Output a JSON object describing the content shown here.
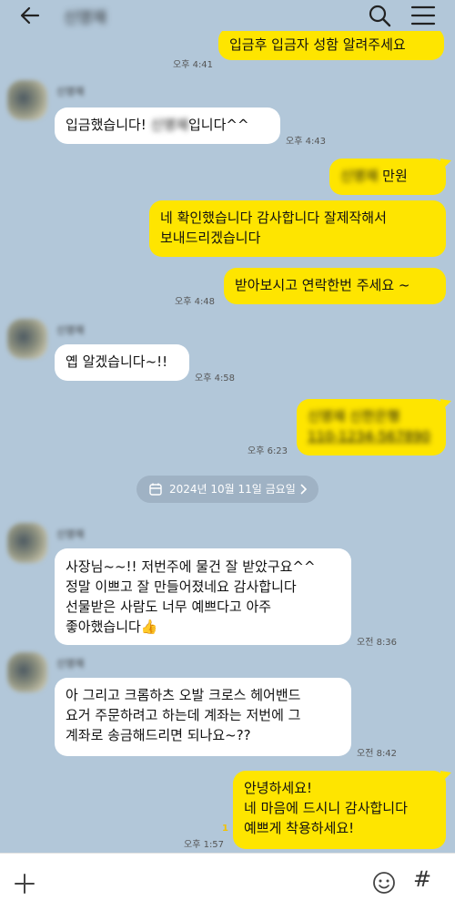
{
  "header": {
    "title": "신영재",
    "back_icon": "back-arrow-icon",
    "search_icon": "search-icon",
    "menu_icon": "hamburger-menu-icon"
  },
  "messages": {
    "m0": {
      "text": "입금후 입금자 성함 알려주세요",
      "time": "오후 4:41"
    },
    "sender_name": "신영재",
    "m1": {
      "text_a": "입금했습니다! ",
      "text_blur": "신영재",
      "text_b": "입니다^^",
      "time": "오후 4:43"
    },
    "m2": {
      "text_blur": "신영재 ",
      "text_b": "만원"
    },
    "m3": {
      "line1": "네 확인했습니다 감사합니다 잘제작해서",
      "line2": "보내드리겠습니다"
    },
    "m4": {
      "text": "받아보시고 연락한번 주세요 ~",
      "time": "오후 4:48"
    },
    "m5": {
      "text": "옙 알겠습니다~!!",
      "time": "오후 4:58"
    },
    "m6": {
      "line1": "신영재 신한은행",
      "line2": "110-1234-567890",
      "time": "오후 6:23"
    },
    "date_divider": "2024년 10월 11일 금요일",
    "m7": {
      "line1": "사장님~~!! 저번주에 물건 잘 받았구요^^",
      "line2": "정말 이쁘고 잘 만들어졌네요 감사합니다",
      "line3": "선물받은 사람도 너무 예쁘다고 아주",
      "line4": "좋아했습니다",
      "emoji": "👍",
      "time": "오전 8:36"
    },
    "m8": {
      "line1": "아 그리고 크롬하츠 오발 크로스 헤어밴드",
      "line2": "요거 주문하려고 하는데 계좌는 저번에 그",
      "line3": "계좌로 송금해드리면 되나요~??",
      "time": "오전 8:42"
    },
    "m9": {
      "line1": "안녕하세요!",
      "line2": "네 마음에 드시니 감사합니다",
      "line3": "예쁘게 착용하세요!",
      "time": "오후 1:57",
      "unread": "1"
    }
  },
  "input_bar": {
    "plus_icon": "plus-icon",
    "emoji_icon": "emoji-icon",
    "hash_label": "#"
  },
  "colors": {
    "background": "#b2c7d9",
    "my_bubble": "#fee500",
    "their_bubble": "#ffffff",
    "unread_count": "#f3c200"
  }
}
